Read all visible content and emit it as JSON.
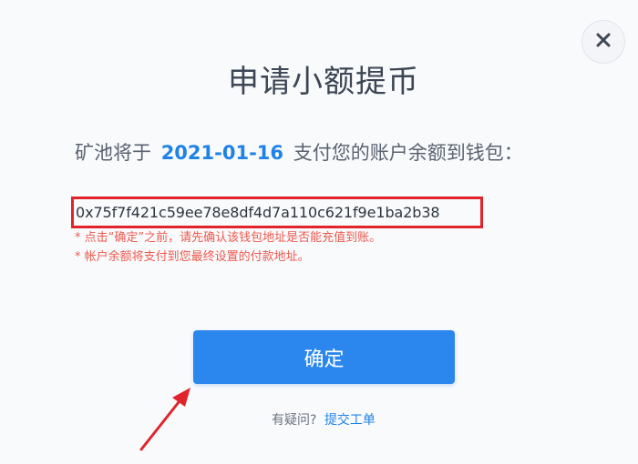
{
  "dialog": {
    "title": "申请小额提币",
    "info": {
      "prefix": "矿池将于",
      "date": "2021-01-16",
      "suffix": "支付您的账户余额到钱包："
    },
    "wallet_address": "0x75f7f421c59ee78e8df4d7a110c621f9e1ba2b38",
    "notes": [
      "* 点击“确定”之前，请先确认该钱包地址是否能充值到账。",
      "* 帐户余额将支付到您最终设置的付款地址。"
    ],
    "confirm_label": "确定",
    "help": {
      "question": "有疑问?",
      "link_label": "提交工单"
    },
    "close_icon": "close-icon"
  },
  "colors": {
    "accent": "#2b86ee",
    "date_highlight": "#1f82e8",
    "warning_text": "#ec5a4e",
    "annotation_red": "#e1242b"
  }
}
